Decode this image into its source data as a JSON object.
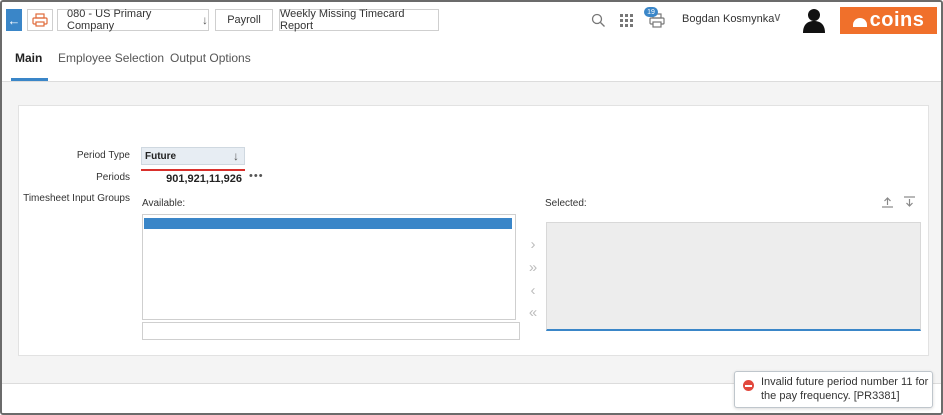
{
  "breadcrumbs": {
    "company": "080 - US Primary Company",
    "module": "Payroll",
    "report": "Weekly Missing Timecard Report"
  },
  "header": {
    "notification_count": "19",
    "user_name": "Bogdan Kosmynka",
    "brand": "coins",
    "brand_color": "#f0702b"
  },
  "tabs": [
    {
      "label": "Main",
      "active": true
    },
    {
      "label": "Employee Selection",
      "active": false
    },
    {
      "label": "Output Options",
      "active": false
    }
  ],
  "form": {
    "period_type_label": "Period Type",
    "period_type_value": "Future",
    "periods_label": "Periods",
    "periods_value": "901,921,11,926",
    "timesheet_groups_label": "Timesheet Input Groups",
    "available_label": "Available:",
    "selected_label": "Selected:"
  },
  "toast": {
    "message": "Invalid future period number 11 for the pay frequency. [PR3381]"
  },
  "icons": {
    "back": "arrow-left-icon",
    "print": "print-icon",
    "search": "search-icon",
    "apps": "apps-grid-icon",
    "printer_queue": "printer-icon",
    "user": "user-avatar-icon",
    "error": "error-icon"
  },
  "accent_color": "#3a86c8",
  "error_color": "#d9302c"
}
